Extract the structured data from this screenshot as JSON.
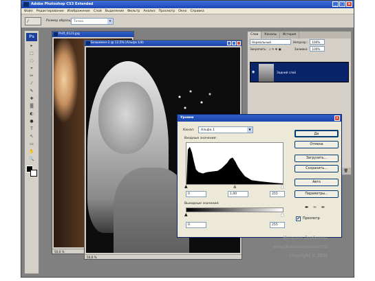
{
  "app": {
    "title": "Adobe Photoshop CS3 Extended",
    "window_buttons": [
      "_",
      "□",
      "x"
    ]
  },
  "menu": [
    "Файл",
    "Редактирование",
    "Изображение",
    "Слой",
    "Выделение",
    "Фильтр",
    "Анализ",
    "Просмотр",
    "Окно",
    "Справка"
  ],
  "options_bar": {
    "tool_glyph": "⁄",
    "label": "Размер образца:",
    "sample_value": "Точка"
  },
  "toolbox": {
    "badge": "Ps",
    "tools": [
      "▸",
      "⬚",
      "◌",
      "⌖",
      "✂",
      "⁄",
      "✎",
      "✚",
      "▒",
      "◐",
      "●",
      "T",
      "↖",
      "▭",
      "✋",
      "🔍"
    ]
  },
  "doc1": {
    "title": "РНЛ_0123.jpg",
    "zoom": "50,0 %"
  },
  "doc2": {
    "title": "Безымянн-2 @ 12,5% (Альфа 1/8)",
    "zoom": "50,0 %"
  },
  "layers_panel": {
    "tabs": [
      "Слои",
      "Каналы",
      "История"
    ],
    "blend_mode": "Нормальный",
    "opacity_label": "Непрозр.:",
    "opacity_value": "100%",
    "lock_label": "Закрепить:",
    "fill_label": "Заливка:",
    "fill_value": "100%",
    "layer_name": "Задний слой",
    "footer_icons": [
      "⛓",
      "fx",
      "◘",
      "◑",
      "▭",
      "▤",
      "🗑"
    ]
  },
  "levels_dialog": {
    "title": "Уровни",
    "close": "x",
    "channel_label": "Канал:",
    "channel_value": "Альфа 1",
    "input_label": "Входные значения:",
    "input_black": "0",
    "input_gamma": "1,00",
    "input_white": "255",
    "output_label": "Выходные значения:",
    "output_black": "0",
    "output_white": "255",
    "buttons": {
      "ok": "Да",
      "cancel": "Отмена",
      "load": "Загрузить...",
      "save": "Сохранить...",
      "auto": "Авто",
      "options": "Параметры..."
    },
    "preview_label": "Просмотр",
    "preview_checked": "✔",
    "dropper_icons": [
      "✒",
      "✒",
      "✒"
    ]
  },
  "watermark": {
    "line1": "Наталья Дербенева",
    "line2": "www.photoshop-master.ru",
    "line3": "Copyright © 2009"
  }
}
